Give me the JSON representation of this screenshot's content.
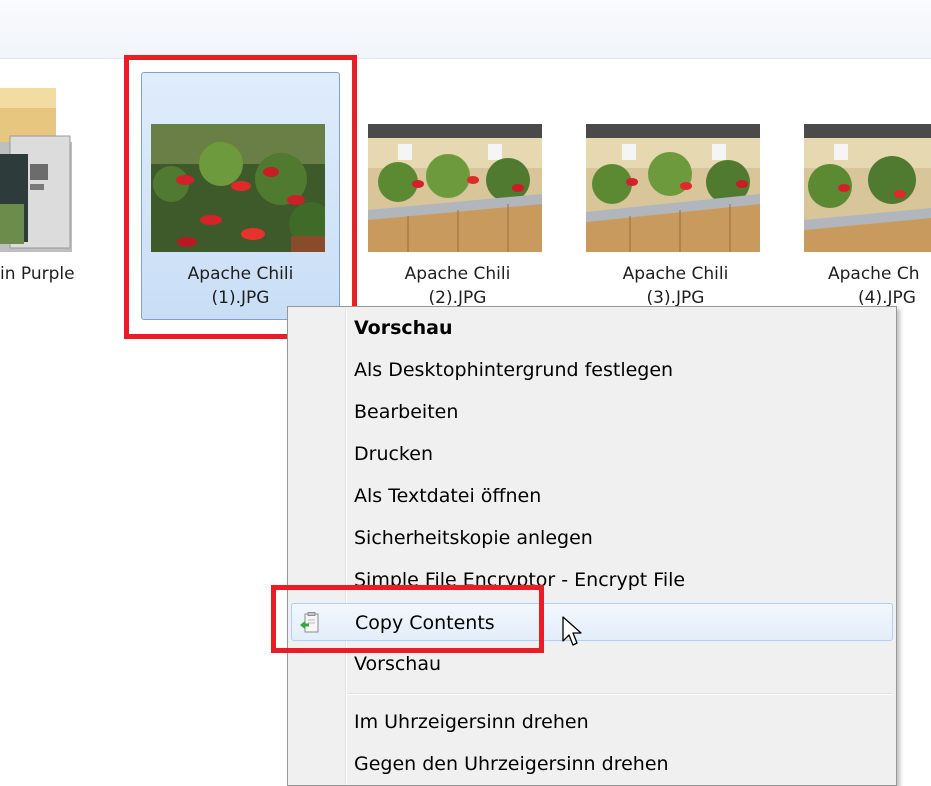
{
  "files": [
    {
      "label_line1": "in Purple",
      "label_line2": ""
    },
    {
      "label_line1": "Apache Chili",
      "label_line2": "(1).JPG"
    },
    {
      "label_line1": "Apache Chili",
      "label_line2": "(2).JPG"
    },
    {
      "label_line1": "Apache Chili",
      "label_line2": "(3).JPG"
    },
    {
      "label_line1": "Apache Ch",
      "label_line2": "(4).JPG"
    }
  ],
  "context_menu": {
    "items": [
      {
        "label": "Vorschau",
        "bold": true
      },
      {
        "label": "Als Desktophintergrund festlegen"
      },
      {
        "label": "Bearbeiten"
      },
      {
        "label": "Drucken"
      },
      {
        "label": "Als Textdatei öffnen"
      },
      {
        "label": "Sicherheitskopie anlegen"
      },
      {
        "label": "Simple File Encryptor - Encrypt File"
      },
      {
        "label": "Copy Contents",
        "icon": "clipboard-green-arrow-icon",
        "hovered": true
      },
      {
        "label": "Vorschau"
      },
      {
        "label": "Im Uhrzeigersinn drehen"
      },
      {
        "label": "Gegen den Uhrzeigersinn drehen"
      }
    ]
  },
  "colors": {
    "selection_bg": "#cfe2f8",
    "highlight_red": "#ec1c24",
    "menu_bg": "#f0f0f0"
  }
}
